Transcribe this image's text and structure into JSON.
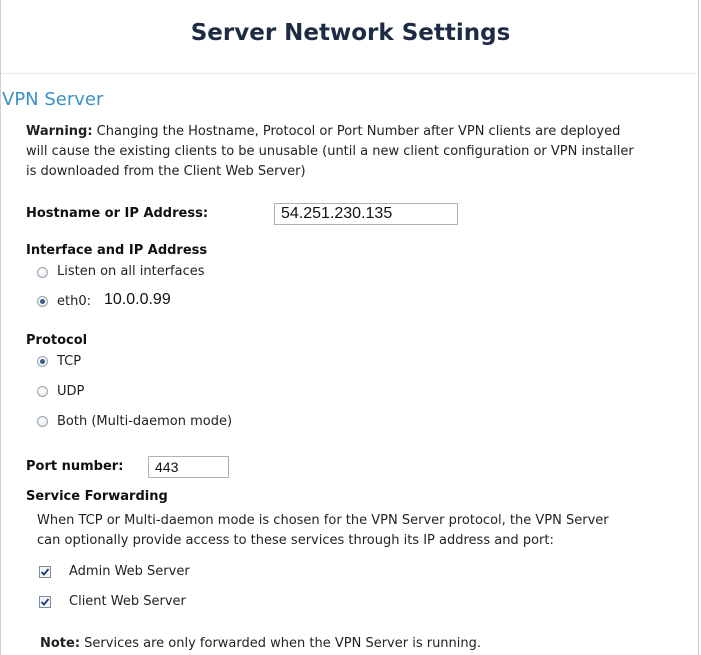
{
  "page_title": "Server Network Settings",
  "section_title": "VPN Server",
  "warning": {
    "label": "Warning:",
    "line1": " Changing the Hostname, Protocol or Port Number after VPN clients are deployed",
    "line2": "will cause the existing clients to be unusable (until a new client configuration or VPN installer",
    "line3": "is downloaded from the Client Web Server)"
  },
  "hostname": {
    "label": "Hostname or IP Address:",
    "value": "54.251.230.135"
  },
  "interface": {
    "label": "Interface and IP Address",
    "options": [
      {
        "label": "Listen on all interfaces",
        "selected": false
      },
      {
        "label": "eth0:",
        "ip": "10.0.0.99",
        "selected": true
      }
    ]
  },
  "protocol": {
    "label": "Protocol",
    "options": [
      {
        "label": "TCP",
        "selected": true
      },
      {
        "label": "UDP",
        "selected": false
      },
      {
        "label": "Both (Multi-daemon mode)",
        "selected": false
      }
    ]
  },
  "port": {
    "label": "Port number:",
    "value": "443"
  },
  "service_forwarding": {
    "label": "Service Forwarding",
    "desc_line1": "When TCP or Multi-daemon mode is chosen for the VPN Server protocol, the VPN Server",
    "desc_line2": "can optionally provide access to these services through its IP address and port:",
    "services": [
      {
        "label": "Admin Web Server",
        "checked": true
      },
      {
        "label": "Client Web Server",
        "checked": true
      }
    ]
  },
  "note": {
    "label": "Note:",
    "text": " Services are only forwarded when the VPN Server is running."
  }
}
